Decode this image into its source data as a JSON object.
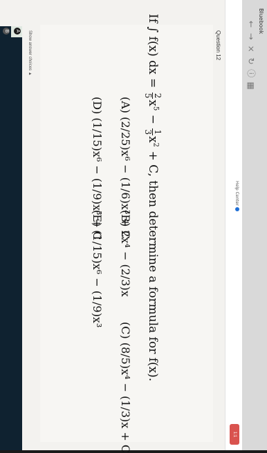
{
  "browser": {
    "tab_title": "Bluebook",
    "nav_icons": [
      "back-icon",
      "forward-icon",
      "close-icon",
      "refresh-icon",
      "info-icon",
      "apps-icon"
    ]
  },
  "header": {
    "help_center": "Help Center",
    "badge": "1:1"
  },
  "question": {
    "label": "Question 12",
    "stem_prefix": "If",
    "stem_suffix": ", then determine a formula for",
    "target": "f(x)."
  },
  "choices": [
    {
      "letter": "(A)",
      "text": "(2/25)x⁶ − (1/6)x³ + C"
    },
    {
      "letter": "(B)",
      "text": "2x⁴ − (2/3)x"
    },
    {
      "letter": "(C)",
      "text": "(8/5)x⁴ − (1/3)x + C"
    },
    {
      "letter": "(D)",
      "text": "(1/15)x⁶ − (1/9)x³ + C"
    },
    {
      "letter": "(E)",
      "text": "(1/15)x⁶ − (1/9)x³"
    }
  ],
  "footer": {
    "show_choices": "Show answer choices ▲",
    "answer_a": "A",
    "answer_b": "B"
  },
  "colors": {
    "accent": "#1f6fd6",
    "badge": "#d9534f",
    "dark_strip": "#0f2230"
  }
}
